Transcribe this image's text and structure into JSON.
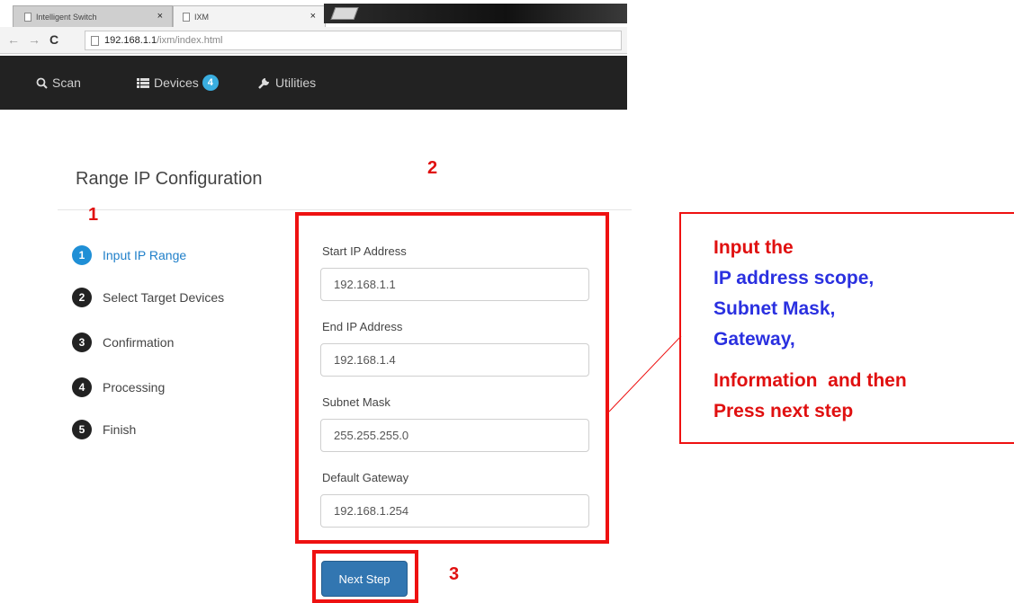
{
  "browser": {
    "tabs": [
      {
        "label": "Intelligent Switch",
        "close": "×"
      },
      {
        "label": "IXM",
        "close": "×"
      }
    ],
    "nav": {
      "back": "←",
      "forward": "→",
      "reload": "C"
    },
    "url_host": "192.168.1.1",
    "url_path": "/ixm/index.html"
  },
  "navbar": {
    "scan_icon": "search-icon",
    "scan_label": "Scan",
    "devices_icon": "list-icon",
    "devices_label": "Devices",
    "devices_badge": "4",
    "utilities_icon": "wrench-icon",
    "utilities_label": "Utilities"
  },
  "page": {
    "title": "Range IP Configuration"
  },
  "steps": [
    {
      "number": "1",
      "label": "Input IP Range",
      "active": true
    },
    {
      "number": "2",
      "label": "Select Target Devices",
      "active": false
    },
    {
      "number": "3",
      "label": "Confirmation",
      "active": false
    },
    {
      "number": "4",
      "label": "Processing",
      "active": false
    },
    {
      "number": "5",
      "label": "Finish",
      "active": false
    }
  ],
  "form": {
    "start_ip": {
      "label": "Start IP Address",
      "value": "192.168.1.1"
    },
    "end_ip": {
      "label": "End IP Address",
      "value": "192.168.1.4"
    },
    "subnet": {
      "label": "Subnet Mask",
      "value": "255.255.255.0"
    },
    "gateway": {
      "label": "Default Gateway",
      "value": "192.168.1.254"
    },
    "next_label": "Next Step"
  },
  "annotations": {
    "marker1": "1",
    "marker2": "2",
    "marker3": "3",
    "accent_color": "#ee1111",
    "callout_lines": [
      {
        "text": "Input the",
        "color": "red"
      },
      {
        "text": "IP address scope,",
        "color": "blue"
      },
      {
        "text": "Subnet Mask,",
        "color": "blue"
      },
      {
        "text": "Gateway,",
        "color": "blue"
      },
      {
        "text": "Information  and then",
        "color": "red"
      },
      {
        "text": "Press next step",
        "color": "red"
      }
    ]
  }
}
